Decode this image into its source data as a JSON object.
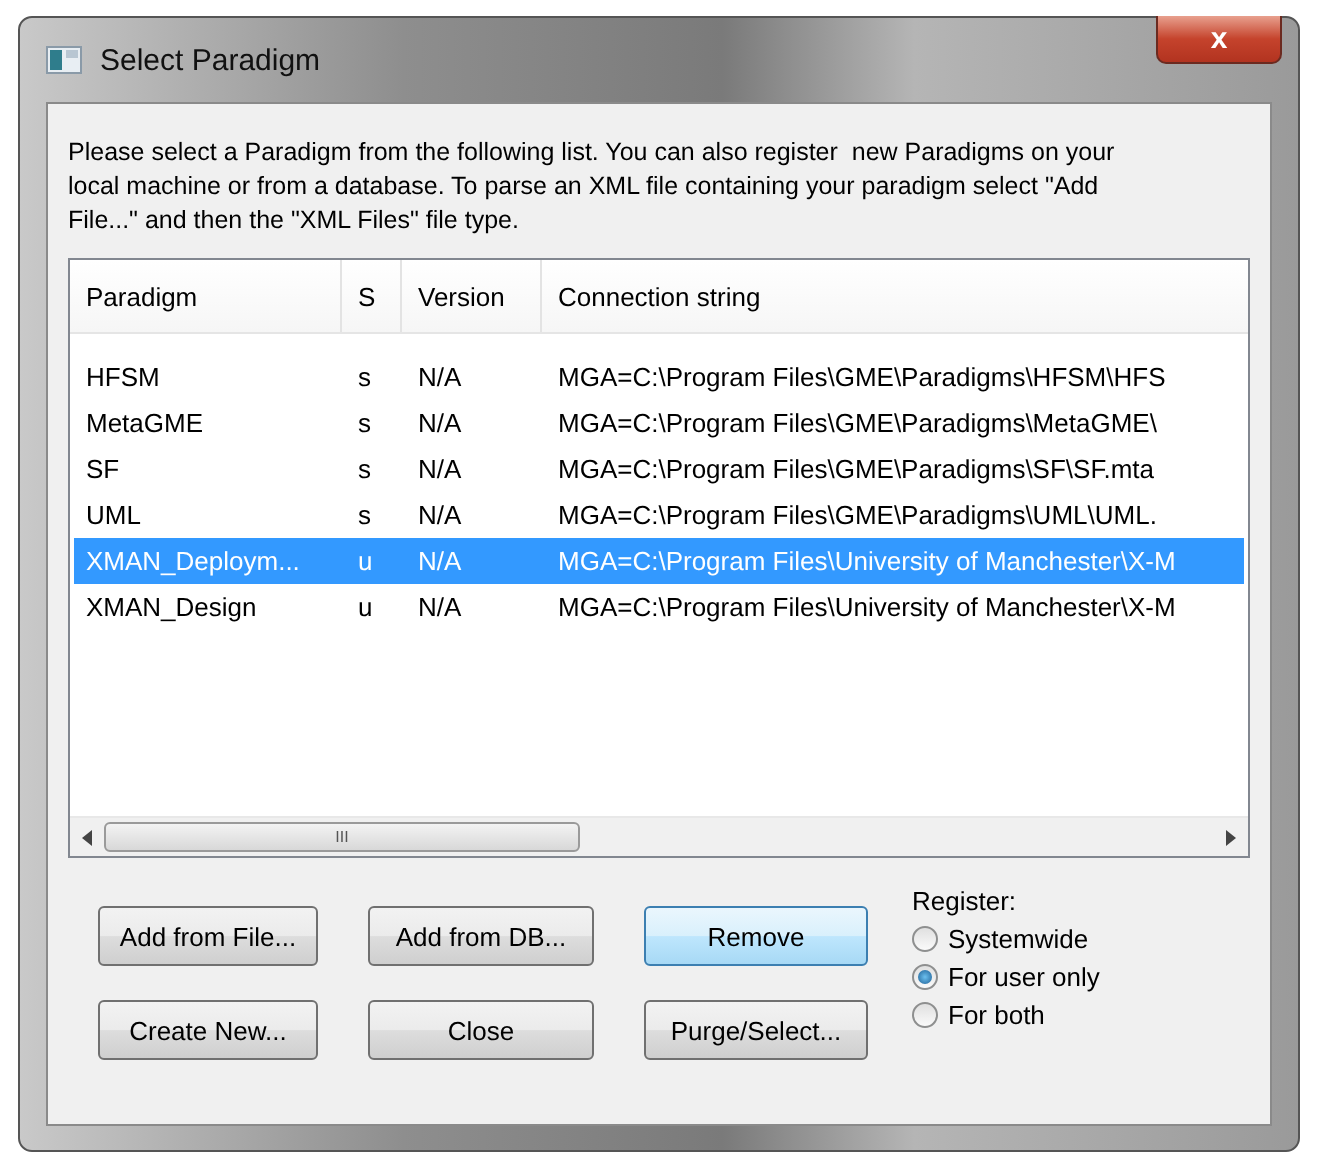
{
  "window": {
    "title": "Select Paradigm"
  },
  "instructions": "Please select a Paradigm from the following list. You can also register  new Paradigms on your local machine or from a database. To parse an XML file containing your paradigm select \"Add File...\" and then the \"XML Files\" file type.",
  "table": {
    "columns": [
      "Paradigm",
      "S",
      "Version",
      "Connection string"
    ],
    "rows": [
      {
        "cells": [
          "HFSM",
          "s",
          "N/A",
          "MGA=C:\\Program Files\\GME\\Paradigms\\HFSM\\HFS"
        ],
        "selected": false
      },
      {
        "cells": [
          "MetaGME",
          "s",
          "N/A",
          "MGA=C:\\Program Files\\GME\\Paradigms\\MetaGME\\"
        ],
        "selected": false
      },
      {
        "cells": [
          "SF",
          "s",
          "N/A",
          "MGA=C:\\Program Files\\GME\\Paradigms\\SF\\SF.mta"
        ],
        "selected": false
      },
      {
        "cells": [
          "UML",
          "s",
          "N/A",
          "MGA=C:\\Program Files\\GME\\Paradigms\\UML\\UML."
        ],
        "selected": false
      },
      {
        "cells": [
          "XMAN_Deploym...",
          "u",
          "N/A",
          "MGA=C:\\Program Files\\University of Manchester\\X-M"
        ],
        "selected": true
      },
      {
        "cells": [
          "XMAN_Design",
          "u",
          "N/A",
          "MGA=C:\\Program Files\\University of Manchester\\X-M"
        ],
        "selected": false
      }
    ],
    "scrollbar_grip": "III"
  },
  "buttons": [
    {
      "label": "Add from File...",
      "focused": false
    },
    {
      "label": "Add from DB...",
      "focused": false
    },
    {
      "label": "Remove",
      "focused": true
    },
    {
      "label": "Create New...",
      "focused": false
    },
    {
      "label": "Close",
      "focused": false
    },
    {
      "label": "Purge/Select...",
      "focused": false
    }
  ],
  "register": {
    "label": "Register:",
    "options": [
      {
        "label": "Systemwide",
        "selected": false
      },
      {
        "label": "For user only",
        "selected": true
      },
      {
        "label": "For both",
        "selected": false
      }
    ]
  },
  "close_glyph": "x"
}
